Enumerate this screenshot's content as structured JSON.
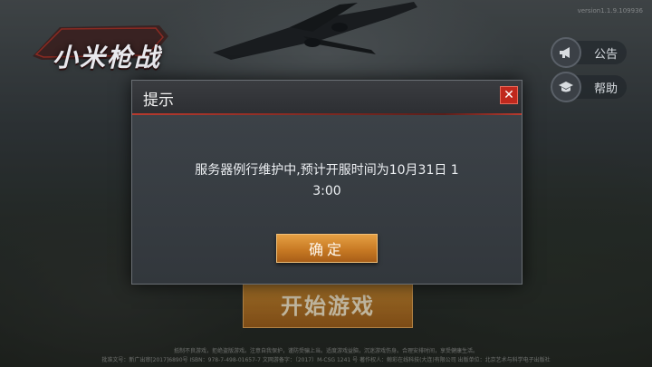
{
  "version_text": "version1.1.9.109936",
  "logo": {
    "text": "小米枪战"
  },
  "side_buttons": {
    "notice_label": "公告",
    "help_label": "帮助"
  },
  "start_button_label": "开始游戏",
  "footer": {
    "line1": "抵制不良游戏，拒绝盗版游戏。注意自我保护，谨防受骗上当。适度游戏益脑，沉迷游戏伤身。合理安排时间，享受健康生活。",
    "line2": "批准文号：新广出审[2017]6890号    ISBN：978-7-498-01657-7    文网游备字：（2017）M-CSG 1241 号    著作权人：鲸彩在线科技(大连)有限公司    出版单位：北京艺术与科学电子出版社"
  },
  "dialog": {
    "title": "提示",
    "close_symbol": "✕",
    "message_line1": "服务器例行维护中,预计开服时间为10月31日 1",
    "message_line2": "3:00",
    "ok_label": "确定"
  }
}
